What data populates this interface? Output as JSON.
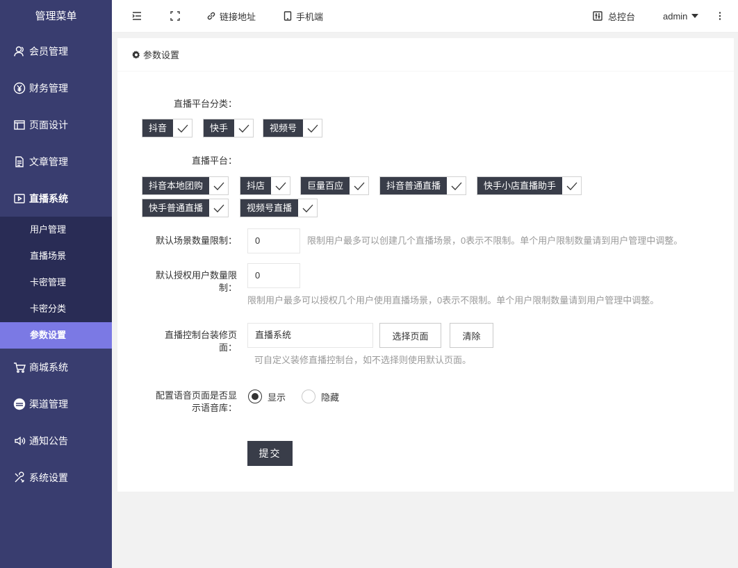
{
  "sidebar": {
    "title": "管理菜单",
    "items": [
      {
        "label": "会员管理",
        "icon": "user-icon"
      },
      {
        "label": "财务管理",
        "icon": "yen-icon"
      },
      {
        "label": "页面设计",
        "icon": "layout-icon"
      },
      {
        "label": "文章管理",
        "icon": "document-icon"
      },
      {
        "label": "直播系统",
        "icon": "live-icon"
      },
      {
        "label": "商城系统",
        "icon": "cart-icon"
      },
      {
        "label": "渠道管理",
        "icon": "channel-icon"
      },
      {
        "label": "通知公告",
        "icon": "speaker-icon"
      },
      {
        "label": "系统设置",
        "icon": "tools-icon"
      }
    ],
    "subitems": [
      {
        "label": "用户管理"
      },
      {
        "label": "直播场景"
      },
      {
        "label": "卡密管理"
      },
      {
        "label": "卡密分类"
      },
      {
        "label": "参数设置"
      }
    ],
    "active_color": "#7b79e4",
    "bg_color": "#393d6f"
  },
  "header": {
    "link_label": "链接地址",
    "mobile_label": "手机端",
    "console_label": "总控台",
    "user": "admin"
  },
  "card": {
    "title": "参数设置"
  },
  "form": {
    "platform_category_label": "直播平台分类：",
    "platform_categories": [
      "抖音",
      "快手",
      "视频号"
    ],
    "platform_label": "直播平台：",
    "platforms": [
      "抖音本地团购",
      "抖店",
      "巨量百应",
      "抖音普通直播",
      "快手小店直播助手",
      "快手普通直播",
      "视频号直播"
    ],
    "scene_limit_label": "默认场景数量限制：",
    "scene_limit_value": "0",
    "scene_limit_hint": "限制用户最多可以创建几个直播场景，0表示不限制。单个用户限制数量请到用户管理中调整。",
    "auth_limit_label_1": "默认授权用户数量限",
    "auth_limit_label_2": "制：",
    "auth_limit_value": "0",
    "auth_limit_hint": "限制用户最多可以授权几个用户使用直播场景，0表示不限制。单个用户限制数量请到用户管理中调整。",
    "console_page_label_1": "直播控制台装修页",
    "console_page_label_2": "面：",
    "console_page_value": "直播系统",
    "select_page_button": "选择页面",
    "clear_button": "清除",
    "console_page_hint": "可自定义装修直播控制台，如不选择则使用默认页面。",
    "voice_label_1": "配置语音页面是否显",
    "voice_label_2": "示语音库：",
    "voice_options": [
      "显示",
      "隐藏"
    ],
    "voice_selected": "显示",
    "submit_label": "提交"
  }
}
